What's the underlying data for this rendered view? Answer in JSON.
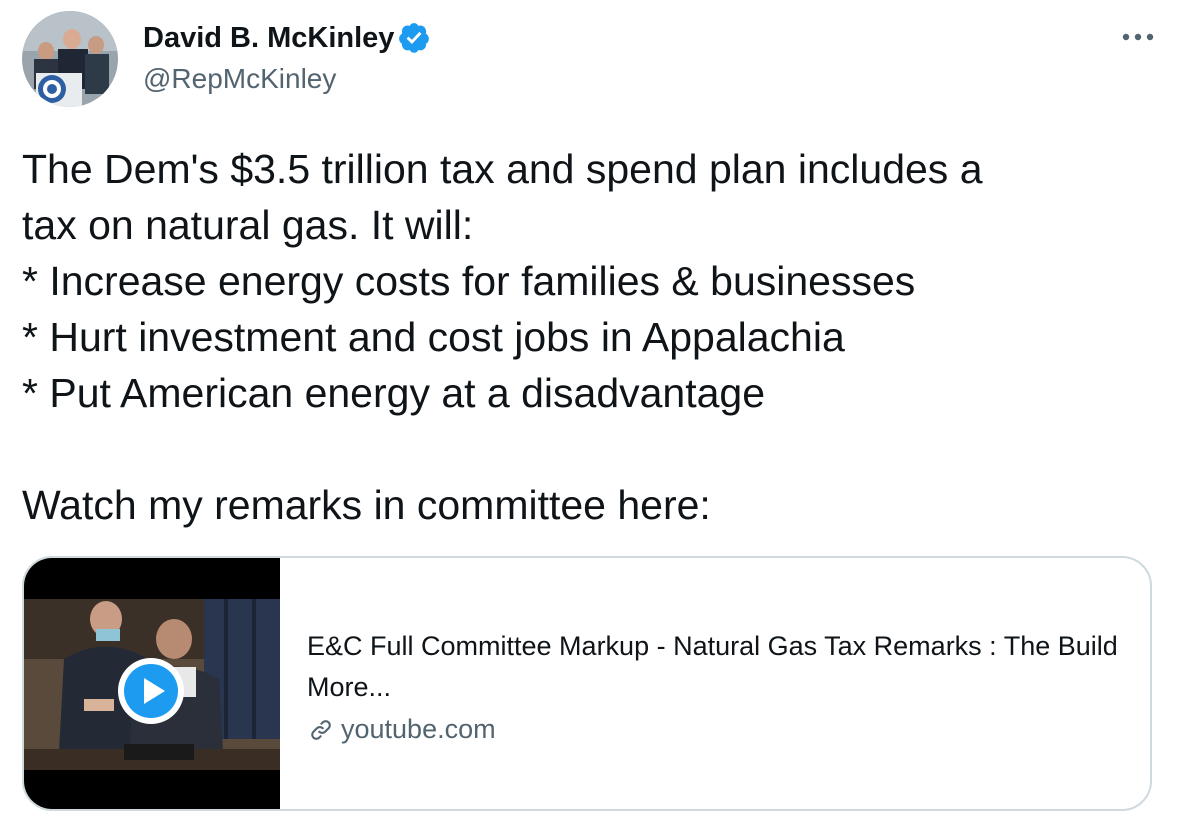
{
  "author": {
    "display_name": "David B. McKinley",
    "handle": "@RepMcKinley",
    "avatar_icon": "avatar-photo",
    "verified": true,
    "verified_color": "#1d9bf0"
  },
  "tweet": {
    "text": "The Dem's $3.5 trillion tax and spend plan includes a\ntax on natural gas. It will:\n* Increase energy costs for families & businesses\n* Hurt investment and cost jobs in Appalachia\n* Put American energy at a disadvantage\n\nWatch my remarks in committee here:"
  },
  "card": {
    "title": "E&C Full Committee Markup - Natural Gas Tax Remarks : The Build More...",
    "domain": "youtube.com",
    "play_icon": "play-icon",
    "link_icon": "link-icon"
  },
  "menu": {
    "icon": "more-options-icon"
  }
}
